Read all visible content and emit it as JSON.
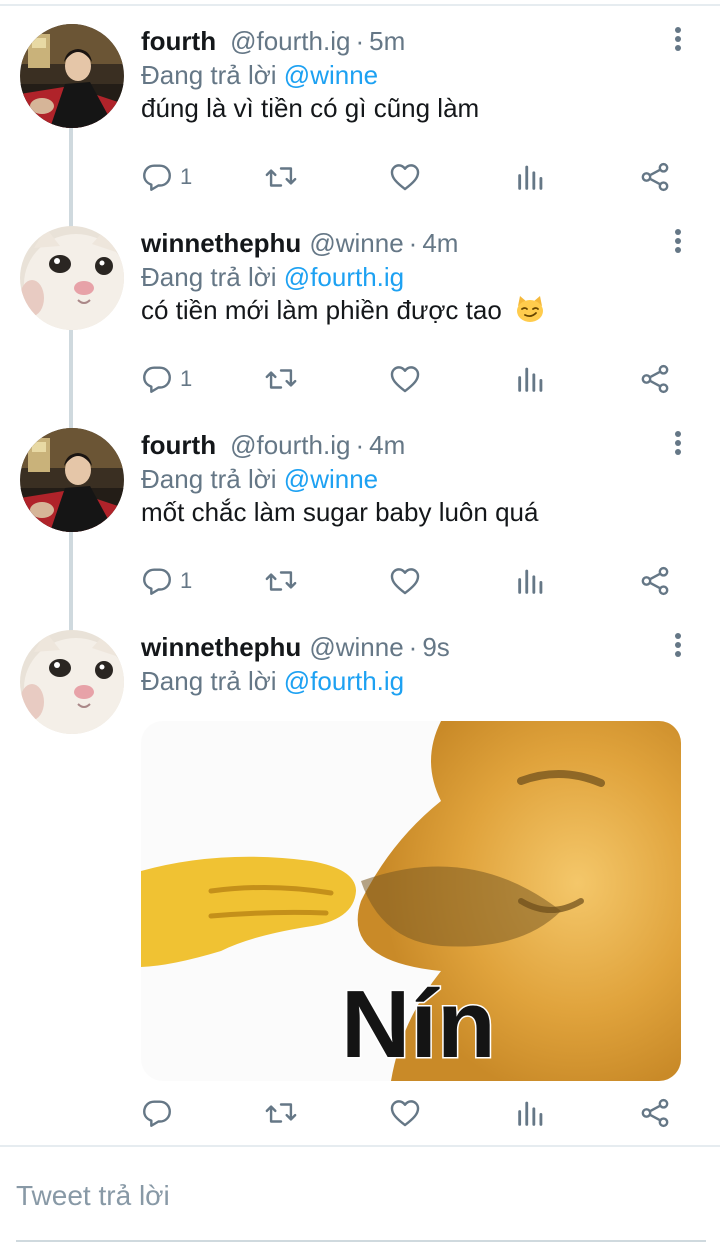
{
  "tweets": [
    {
      "name": "fourth",
      "handle": "@fourth.ig",
      "separator": "·",
      "time": "5m",
      "replying_prefix": "Đang trả lời",
      "replying_to": "@winne",
      "text": "đúng là vì tiền có gì cũng làm",
      "reply_count": "1"
    },
    {
      "name": "winnethephu",
      "handle": "@winne",
      "separator": "·",
      "time": "4m",
      "replying_prefix": "Đang trả lời",
      "replying_to": "@fourth.ig",
      "text": "có tiền mới làm phiền được tao",
      "reply_count": "1"
    },
    {
      "name": "fourth",
      "handle": "@fourth.ig",
      "separator": "·",
      "time": "4m",
      "replying_prefix": "Đang trả lời",
      "replying_to": "@winne",
      "text": "mốt chắc làm sugar baby luôn quá",
      "reply_count": "1"
    },
    {
      "name": "winnethephu",
      "handle": "@winne",
      "separator": "·",
      "time": "9s",
      "replying_prefix": "Đang trả lời",
      "replying_to": "@fourth.ig",
      "text": "",
      "reply_count": "",
      "media_caption": "Nín"
    }
  ],
  "reply_input": {
    "placeholder": "Tweet trả lời"
  },
  "colors": {
    "link": "#1da1f2",
    "secondary_text": "#657786",
    "primary_text": "#14171a",
    "divider": "#e6ecf0"
  },
  "icons": [
    "reply-icon",
    "retweet-icon",
    "like-icon",
    "analytics-icon",
    "share-icon",
    "more-icon",
    "smirk-cat-emoji"
  ]
}
